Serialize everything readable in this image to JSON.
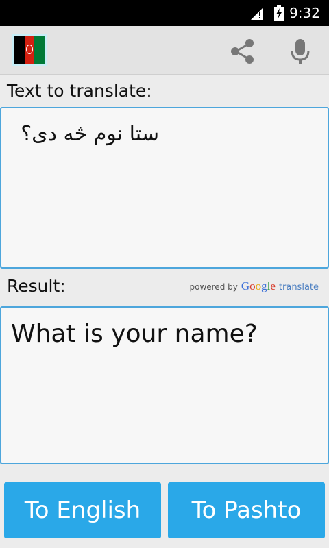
{
  "status_bar": {
    "time": "9:32"
  },
  "action_bar": {
    "icons": [
      "afghanistan-flag",
      "share-icon",
      "microphone-icon"
    ]
  },
  "input": {
    "label": "Text to translate:",
    "value": "ستا نوم څه دی؟"
  },
  "result": {
    "label": "Result:",
    "value": "What is your name?"
  },
  "attribution": {
    "powered_by": "powered by",
    "brand": "Google",
    "suffix": "translate"
  },
  "buttons": {
    "to_english": "To English",
    "to_pashto": "To Pashto"
  },
  "colors": {
    "accent": "#2aa8e8",
    "panel_border": "#4da6dc",
    "status_bar": "#000000",
    "action_bar": "#e3e3e3"
  }
}
